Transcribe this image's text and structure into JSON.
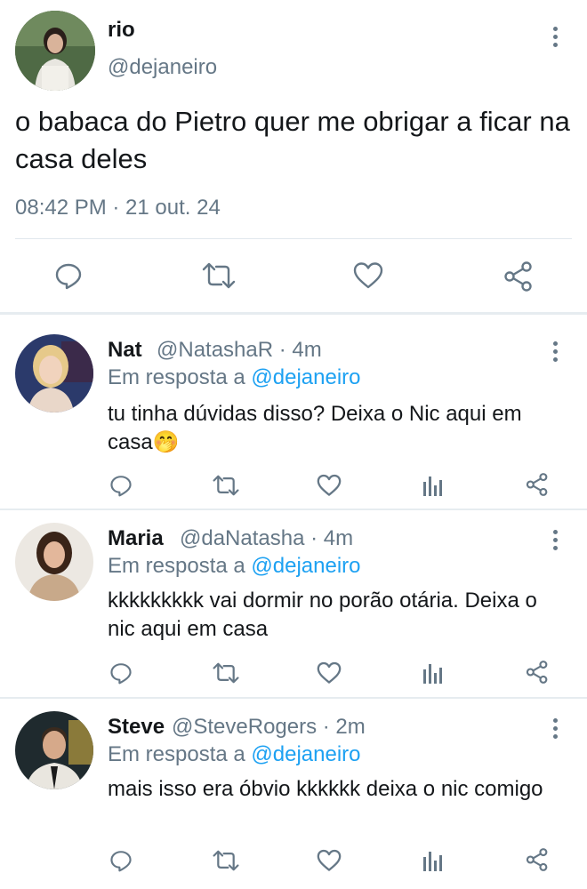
{
  "main_tweet": {
    "name": "rio",
    "handle": "@dejaneiro",
    "text": "o babaca do Pietro quer me obrigar a ficar na casa deles",
    "timestamp": "08:42 PM · 21 out. 24",
    "actions": [
      "reply-icon",
      "retweet-icon",
      "like-icon",
      "share-icon"
    ]
  },
  "in_reply_prefix": "Em resposta a",
  "replies": [
    {
      "name": "Nat",
      "handle_time": "@NatashaR · 4m",
      "mention": "@dejaneiro",
      "text": "tu tinha dúvidas disso? Deixa o Nic aqui em casa🤭"
    },
    {
      "name": "Maria",
      "handle_time": "@daNatasha · 4m",
      "mention": "@dejaneiro",
      "text": "kkkkkkkkk vai dormir no porão otária. Deixa o nic aqui em casa"
    },
    {
      "name": "Steve",
      "handle_time": "@SteveRogers · 2m",
      "mention": "@dejaneiro",
      "text": "mais isso era óbvio kkkkkk deixa o nic comigo"
    }
  ],
  "colors": {
    "text": "#14171a",
    "secondary": "#657786",
    "link": "#1da1f2",
    "divider": "#e6ecf0"
  }
}
